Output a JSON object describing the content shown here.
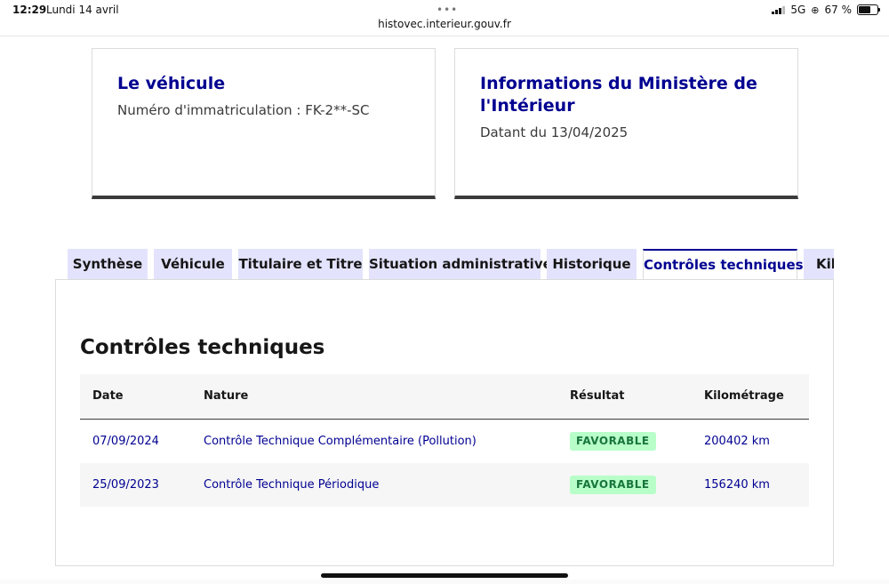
{
  "status_bar": {
    "time": "12:29",
    "date": "Lundi 14 avril",
    "url": "histovec.interieur.gouv.fr",
    "network": "5G",
    "battery": "67 %"
  },
  "cards": {
    "vehicle": {
      "title": "Le véhicule",
      "subtitle": "Numéro d'immatriculation : FK-2**-SC"
    },
    "ministry": {
      "title": "Informations du Ministère de l'Intérieur",
      "subtitle": "Datant du 13/04/2025"
    }
  },
  "tabs": [
    {
      "label": "Synthèse"
    },
    {
      "label": "Véhicule"
    },
    {
      "label": "Titulaire et Titre"
    },
    {
      "label": "Situation administrative"
    },
    {
      "label": "Historique"
    },
    {
      "label": "Contrôles techniques"
    },
    {
      "label": "Kilométrage"
    }
  ],
  "active_tab": "Contrôles techniques",
  "section": {
    "title": "Contrôles techniques",
    "columns": [
      "Date",
      "Nature",
      "Résultat",
      "Kilométrage"
    ],
    "rows": [
      {
        "date": "07/09/2024",
        "nature": "Contrôle Technique Complémentaire (Pollution)",
        "result": "FAVORABLE",
        "km": "200402 km"
      },
      {
        "date": "25/09/2023",
        "nature": "Contrôle Technique Périodique",
        "result": "FAVORABLE",
        "km": "156240 km"
      }
    ]
  },
  "colors": {
    "primary_blue": "#000091",
    "tab_bg": "#e3e3fd",
    "badge_bg": "#b8fec9",
    "badge_text": "#18753c"
  }
}
